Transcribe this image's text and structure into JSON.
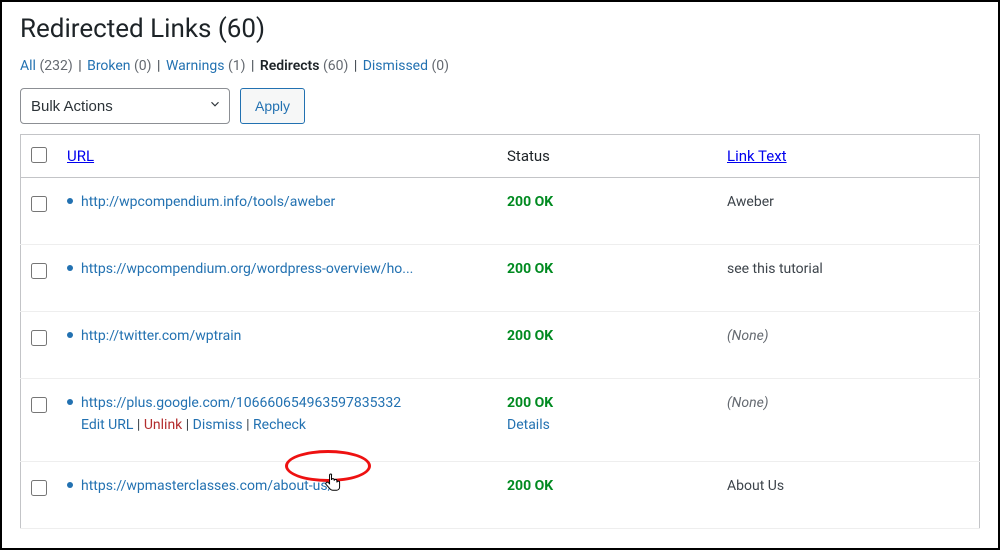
{
  "page": {
    "title": "Redirected Links (60)"
  },
  "filters": {
    "all": {
      "label": "All",
      "count": "(232)"
    },
    "broken": {
      "label": "Broken",
      "count": "(0)"
    },
    "warnings": {
      "label": "Warnings",
      "count": "(1)"
    },
    "redirects": {
      "label": "Redirects",
      "count": "(60)"
    },
    "dismissed": {
      "label": "Dismissed",
      "count": "(0)"
    }
  },
  "bulk": {
    "placeholder": "Bulk Actions",
    "apply": "Apply"
  },
  "columns": {
    "url": "URL",
    "status": "Status",
    "linktext": "Link Text"
  },
  "row_actions": {
    "edit": "Edit URL",
    "unlink": "Unlink",
    "dismiss": "Dismiss",
    "recheck": "Recheck",
    "details": "Details"
  },
  "rows": [
    {
      "url": "http://wpcompendium.info/tools/aweber",
      "status": "200 OK",
      "linktext": "Aweber",
      "none": false,
      "actions": false
    },
    {
      "url": "https://wpcompendium.org/wordpress-overview/ho...",
      "status": "200 OK",
      "linktext": "see this tutorial",
      "none": false,
      "actions": false
    },
    {
      "url": "http://twitter.com/wptrain",
      "status": "200 OK",
      "linktext": "(None)",
      "none": true,
      "actions": false
    },
    {
      "url": "https://plus.google.com/106660654963597835332",
      "status": "200 OK",
      "linktext": "(None)",
      "none": true,
      "actions": true
    },
    {
      "url": "https://wpmasterclasses.com/about-us/",
      "status": "200 OK",
      "linktext": "About Us",
      "none": false,
      "actions": false
    }
  ]
}
